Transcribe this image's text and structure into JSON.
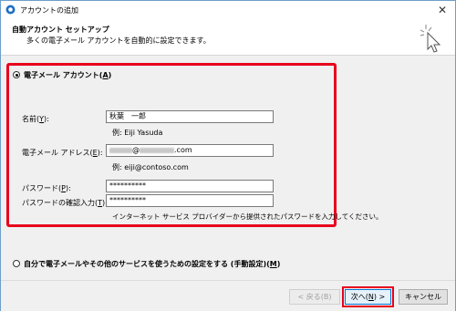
{
  "window": {
    "title": "アカウントの追加",
    "close_glyph": "✕"
  },
  "header": {
    "title": "自動アカウント セットアップ",
    "subtitle": "多くの電子メール アカウントを自動的に設定できます。"
  },
  "email_account": {
    "option_label_prefix": "電子メール アカウント(",
    "option_label_key": "A",
    "option_label_suffix": ")",
    "selected": true,
    "name": {
      "label_prefix": "名前(",
      "label_key": "Y",
      "label_suffix": "):",
      "value": "秋葉　一郎",
      "example": "例: Eiji Yasuda"
    },
    "address": {
      "label_prefix": "電子メール アドレス(",
      "label_key": "E",
      "label_suffix": "):",
      "value_at": "@",
      "value_tail": ".com",
      "example": "例: eiji@contoso.com"
    },
    "password": {
      "label_prefix": "パスワード(",
      "label_key": "P",
      "label_suffix": "):",
      "value": "**********"
    },
    "password_confirm": {
      "label_prefix": "パスワードの確認入力(",
      "label_key": "T",
      "label_suffix": "):",
      "value": "**********"
    },
    "hint": "インターネット サービス プロバイダーから提供されたパスワードを入力してください。"
  },
  "manual_setup": {
    "option_label_prefix": "自分で電子メールやその他のサービスを使うための設定をする (手動設定)(",
    "option_label_key": "M",
    "option_label_suffix": ")",
    "selected": false
  },
  "buttons": {
    "back": "< 戻る(B)",
    "next_prefix": "次へ(",
    "next_key": "N",
    "next_suffix": ") >",
    "cancel": "キャンセル"
  },
  "colors": {
    "highlight": "#e8001c",
    "accent": "#0078d7"
  }
}
